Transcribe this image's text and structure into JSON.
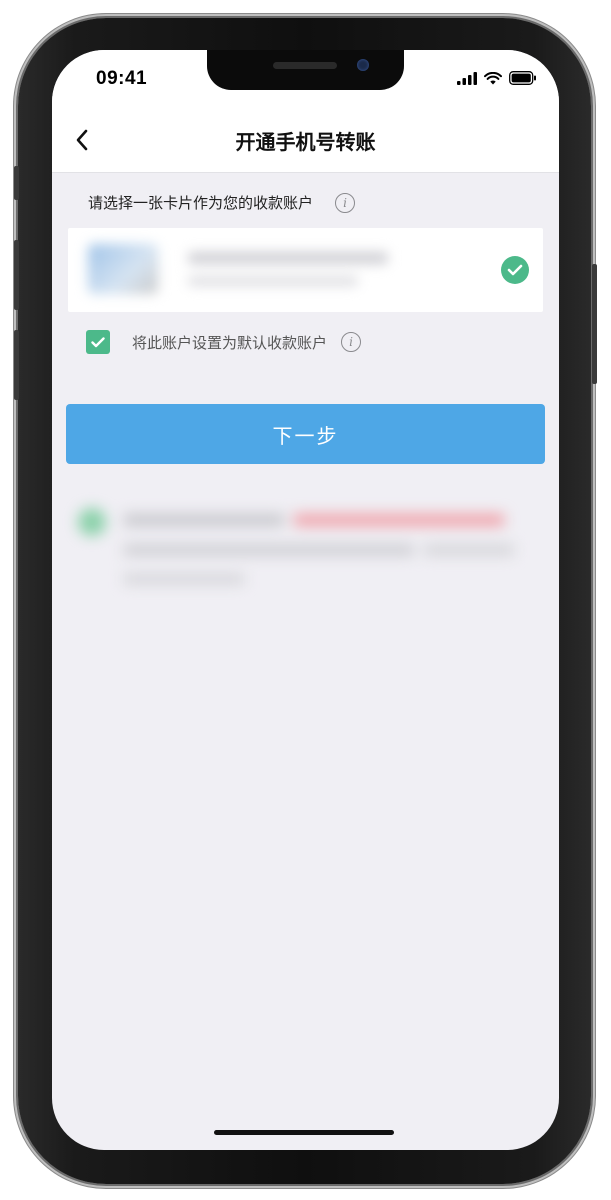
{
  "status_bar": {
    "time": "09:41",
    "icons": [
      "signal-icon",
      "wifi-icon",
      "battery-icon"
    ]
  },
  "nav": {
    "back_icon": "chevron-left-icon",
    "title": "开通手机号转账"
  },
  "account_section": {
    "label": "请选择一张卡片作为您的收款账户",
    "info_icon": "info-icon",
    "selected": true
  },
  "default_option": {
    "label": "将此账户设置为默认收款账户",
    "checked": true
  },
  "next_button": {
    "label": "下一步"
  },
  "colors": {
    "accent_blue": "#4ea7e6",
    "check_green": "#4cb98a",
    "background": "#f0eff4"
  }
}
